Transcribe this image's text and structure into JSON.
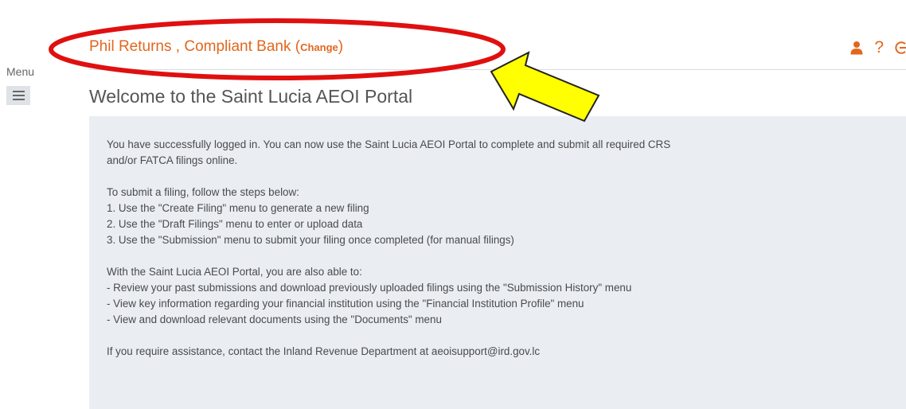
{
  "sidebar": {
    "menu_label": "Menu"
  },
  "header": {
    "user_name": "Phil Returns",
    "separator": " , ",
    "bank_name": "Compliant Bank",
    "change_open": " (",
    "change_label": "Change",
    "change_close": ")",
    "icons": [
      "user-icon",
      "help-icon",
      "logout-icon"
    ],
    "help_glyph": "?"
  },
  "page": {
    "title": "Welcome to the Saint Lucia AEOI Portal"
  },
  "content": {
    "intro_line1": "You have successfully logged in. You can now use the Saint Lucia AEOI Portal to complete and submit all required CRS",
    "intro_line2": "and/or FATCA filings online.",
    "steps_heading": "To submit a filing, follow the steps below:",
    "steps": [
      "1. Use the \"Create Filing\" menu to generate a new filing",
      "2. Use the \"Draft Filings\" menu to enter or upload data",
      "3. Use the \"Submission\" menu to submit your filing once completed (for manual filings)"
    ],
    "abilities_heading": "With the Saint Lucia AEOI Portal, you are also able to:",
    "abilities": [
      "- Review your past submissions and download previously uploaded filings using the \"Submission History\" menu",
      "- View key information regarding your financial institution using the \"Financial Institution Profile\" menu",
      "- View and download relevant documents using the \"Documents\" menu"
    ],
    "assistance": "If you require assistance, contact the Inland Revenue Department at aeoisupport@ird.gov.lc"
  },
  "colors": {
    "accent": "#e2671d",
    "panel_background": "#eaeef3",
    "annotation_ellipse": "#e01010",
    "annotation_arrow": "#ffff00"
  }
}
